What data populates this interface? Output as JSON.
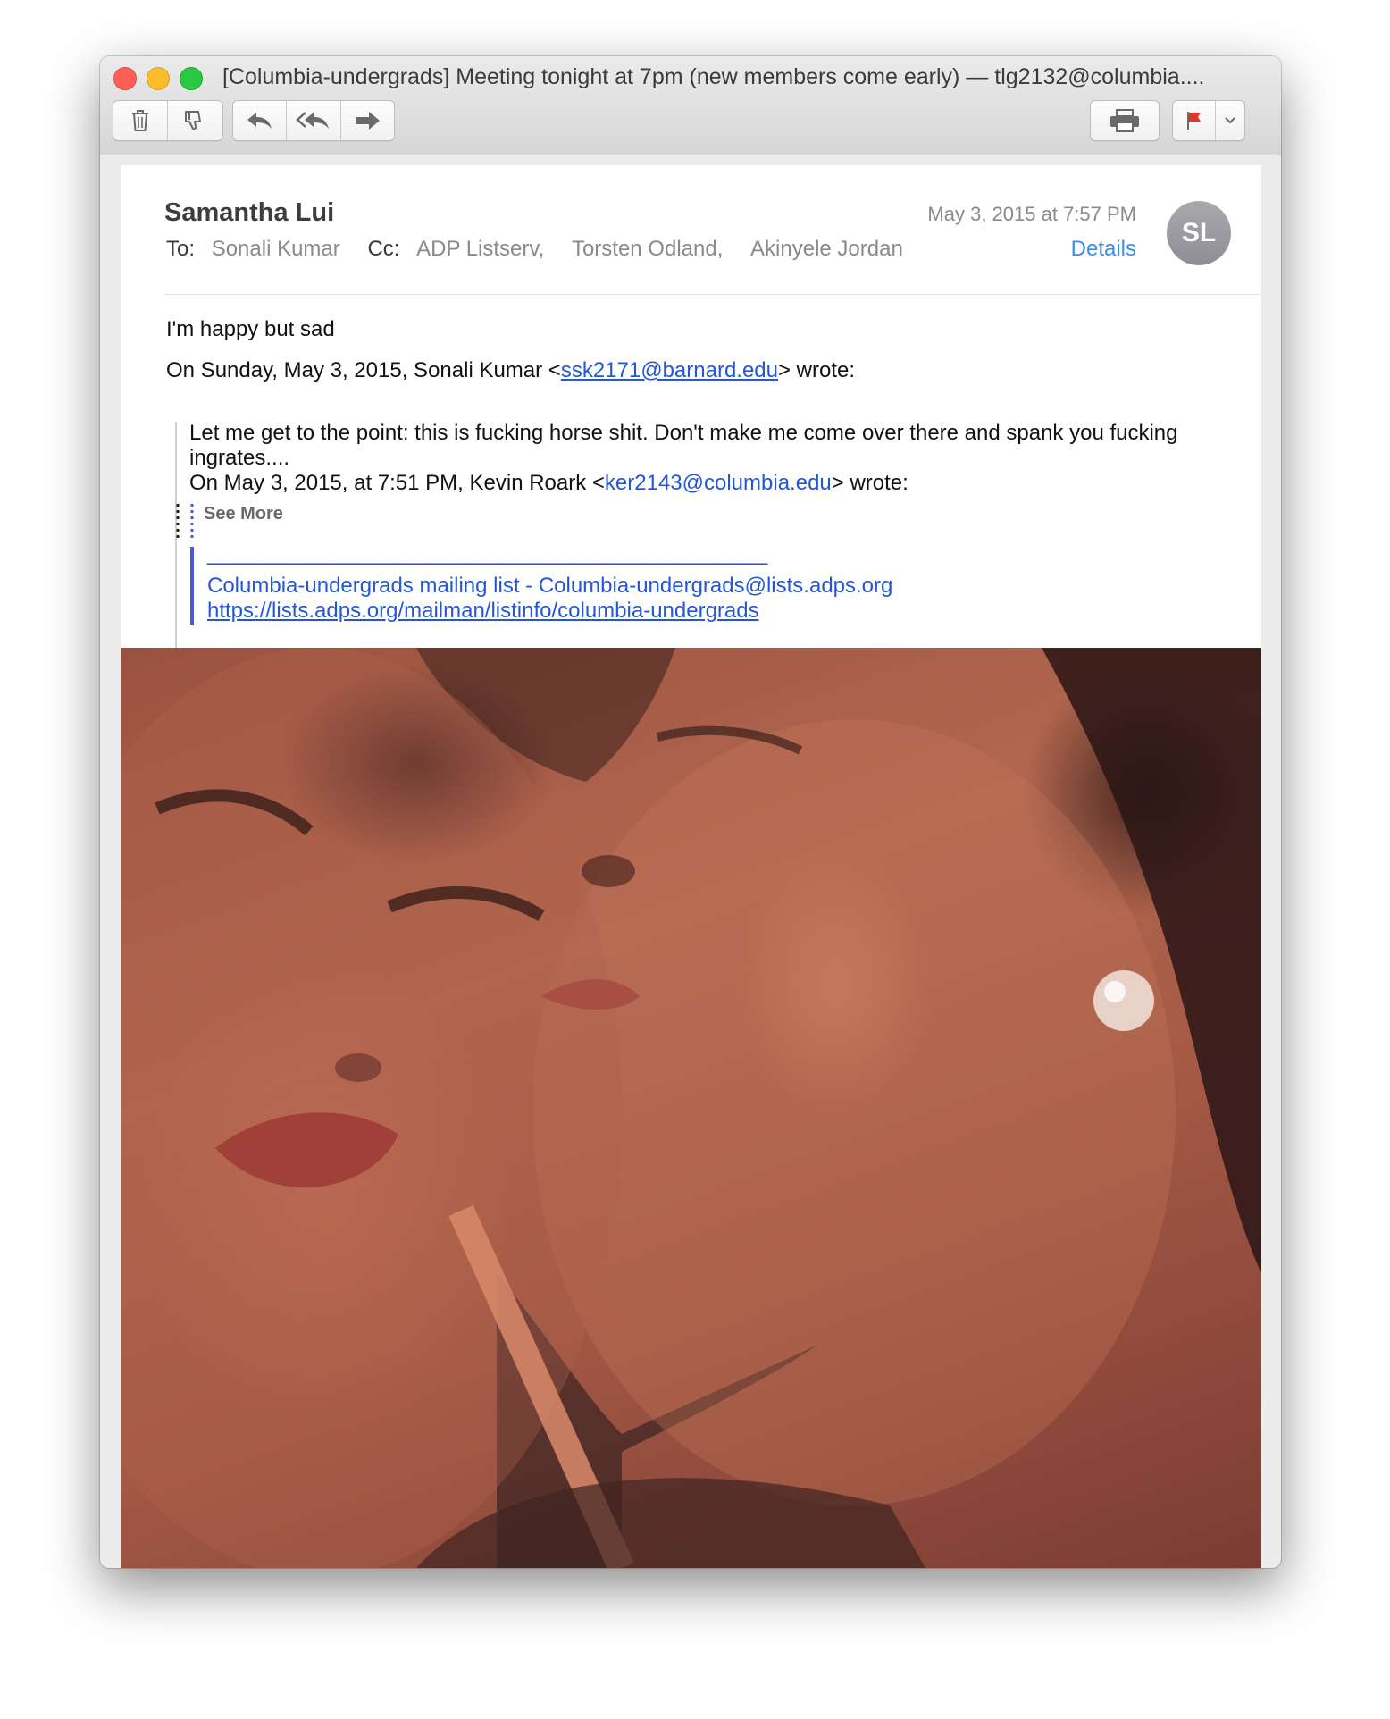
{
  "window": {
    "title": "[Columbia-undergrads] Meeting tonight at 7pm (new members come early) — tlg2132@columbia...."
  },
  "toolbar": {
    "buttons": [
      "trash-icon",
      "junk-icon",
      "reply-icon",
      "reply-all-icon",
      "forward-icon",
      "print-icon",
      "flag-icon",
      "chevron-down-icon"
    ],
    "flag_color": "#e0352b"
  },
  "message": {
    "sender": "Samantha Lui",
    "date": "May 3, 2015 at 7:57 PM",
    "details_label": "Details",
    "avatar_initials": "SL",
    "to_label": "To:",
    "to": [
      "Sonali Kumar"
    ],
    "cc_label": "Cc:",
    "cc": [
      "ADP Listserv,",
      "Torsten Odland,",
      "Akinyele Jordan"
    ]
  },
  "body": {
    "line1": "I'm happy but sad",
    "reply_header_prefix": "On Sunday, May 3, 2015, Sonali Kumar <",
    "reply_header_email": "ssk2171@barnard.edu",
    "reply_header_suffix": "> wrote:",
    "quote_text": "Let me get to the point: this is fucking horse shit. Don't make me come over there and spank you fucking ingrates....",
    "quote_header_prefix": "On May 3, 2015, at 7:51 PM, Kevin Roark <",
    "quote_header_email": "ker2143@columbia.edu",
    "quote_header_suffix": "> wrote:",
    "see_more": "See More",
    "list_separator": "_______________________________________________",
    "list_name_line": "Columbia-undergrads mailing list  -  Columbia-undergrads@lists.adps.org",
    "list_url": "https://lists.adps.org/mailman/listinfo/columbia-undergrads"
  },
  "colors": {
    "link": "#2457d6",
    "quote_bar": "#4b5cd1",
    "details": "#3a8ee6"
  }
}
